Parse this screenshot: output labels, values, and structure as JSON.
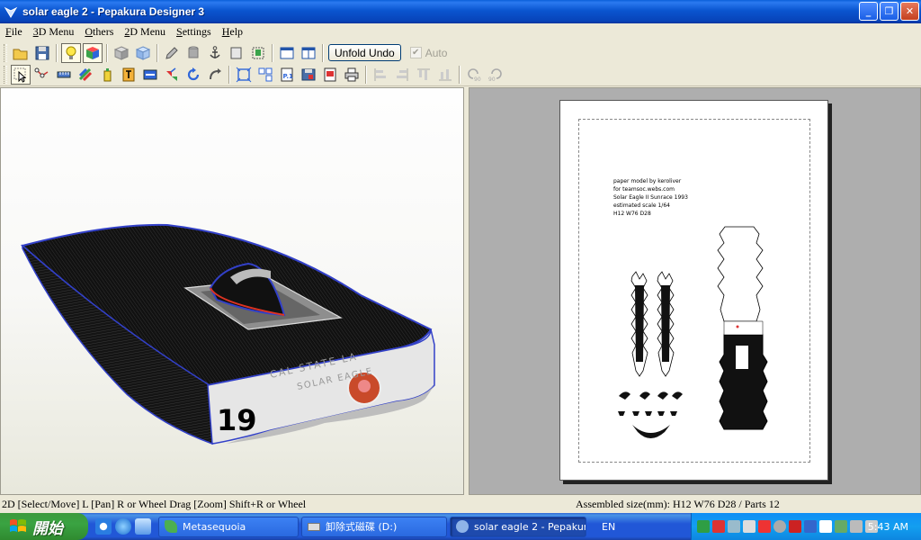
{
  "window": {
    "title": "solar eagle 2 - Pepakura Designer 3"
  },
  "menu": [
    "File",
    "3D Menu",
    "Others",
    "2D Menu",
    "Settings",
    "Help"
  ],
  "toolbar": {
    "unfold_undo": "Unfold Undo",
    "auto_label": "Auto",
    "auto_checked": true
  },
  "model3d": {
    "number": "19",
    "text_line1": "CAL STATE LA",
    "text_line2": "SOLAR EAGLE"
  },
  "page2d": {
    "notes": [
      "paper model by keroliver",
      "for teamsoc.webs.com",
      "Solar Eagle II Sunrace 1993",
      "estimated scale 1/64",
      "H12 W76 D28"
    ]
  },
  "status": {
    "left": "2D [Select/Move] L [Pan] R or Wheel Drag [Zoom] Shift+R or Wheel",
    "right": "Assembled size(mm): H12 W76 D28 / Parts 12"
  },
  "taskbar": {
    "start_label": "開始",
    "tasks": [
      {
        "label": "Metasequoia",
        "active": false
      },
      {
        "label": "卸除式磁碟 (D:)",
        "active": false
      },
      {
        "label": "solar eagle 2 - Pepakur...",
        "active": true
      }
    ],
    "language": "EN",
    "clock": "5:43 AM"
  }
}
